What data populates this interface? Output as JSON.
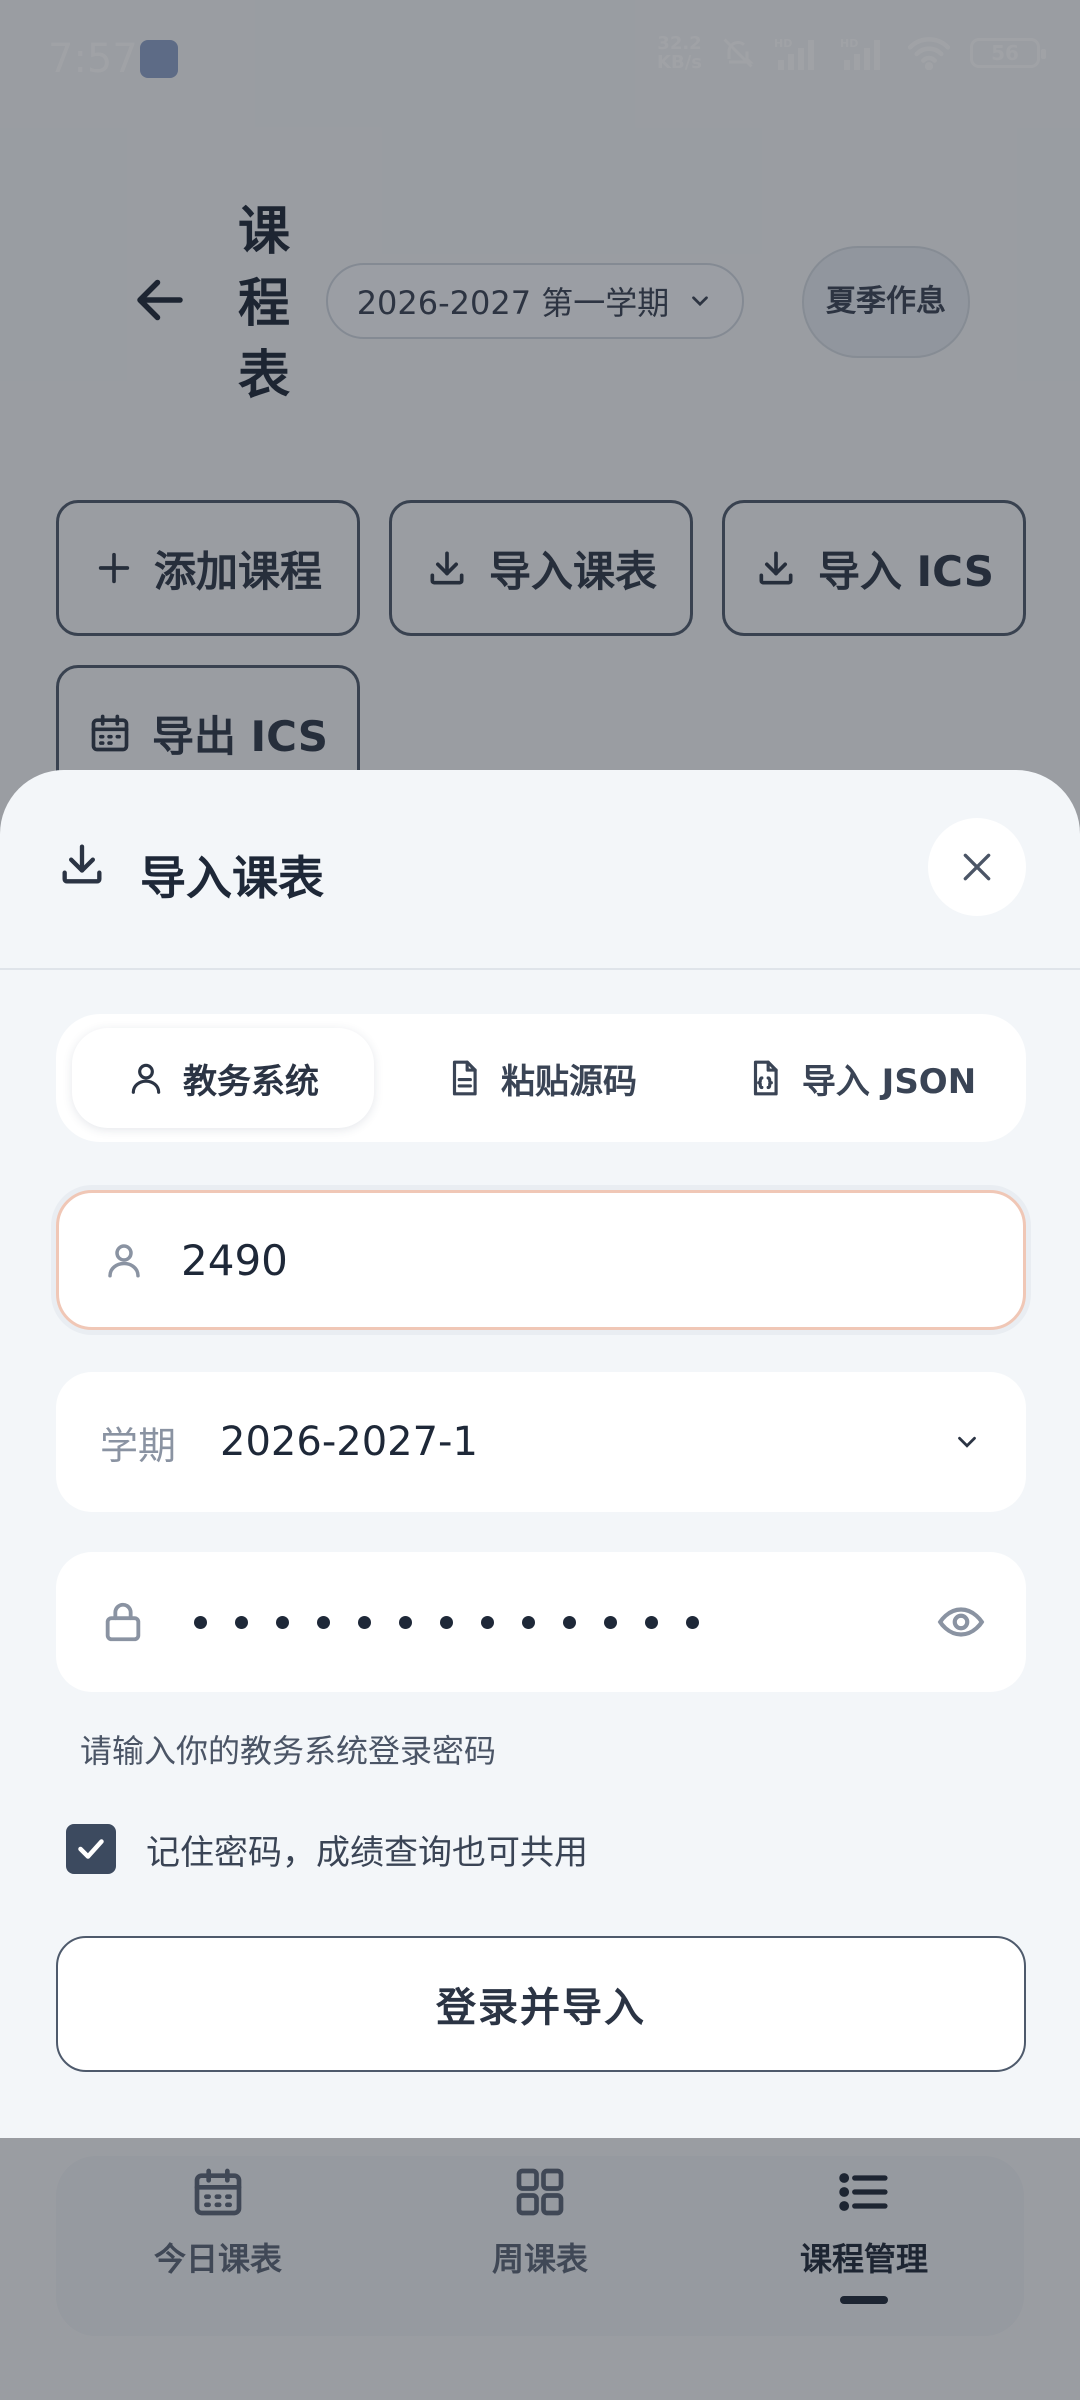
{
  "status_bar": {
    "time": "7:57",
    "net_speed_top": "32.2",
    "net_speed_bottom": "KB/s",
    "hd1": "HD",
    "hd2": "HD",
    "battery": "56"
  },
  "header": {
    "title": "课程表",
    "term_selector": "2026-2027 第一学期",
    "summer_schedule": "夏季作息"
  },
  "actions": {
    "add_course": "添加课程",
    "import_schedule": "导入课表",
    "import_ics": "导入 ICS",
    "export_ics": "导出 ICS"
  },
  "bottom_nav": {
    "items": [
      {
        "label": "今日课表",
        "icon": "calendar-icon"
      },
      {
        "label": "周课表",
        "icon": "grid-icon"
      },
      {
        "label": "课程管理",
        "icon": "list-icon",
        "active": true
      }
    ]
  },
  "sheet": {
    "title": "导入课表",
    "tabs": [
      {
        "label": "教务系统",
        "icon": "person-icon",
        "active": true
      },
      {
        "label": "粘贴源码",
        "icon": "document-icon"
      },
      {
        "label": "导入 JSON",
        "icon": "json-file-icon"
      }
    ],
    "username_value": "2490",
    "term_label": "学期",
    "term_value": "2026-2027-1",
    "password_length": 13,
    "password_helper": "请输入你的教务系统登录密码",
    "remember_checked": true,
    "remember_label": "记住密码，成绩查询也可共用",
    "submit_label": "登录并导入"
  },
  "colors": {
    "accent": "#3c4a5f",
    "focus_border": "#f0c7b6",
    "sheet_bg": "#f3f6f9"
  }
}
